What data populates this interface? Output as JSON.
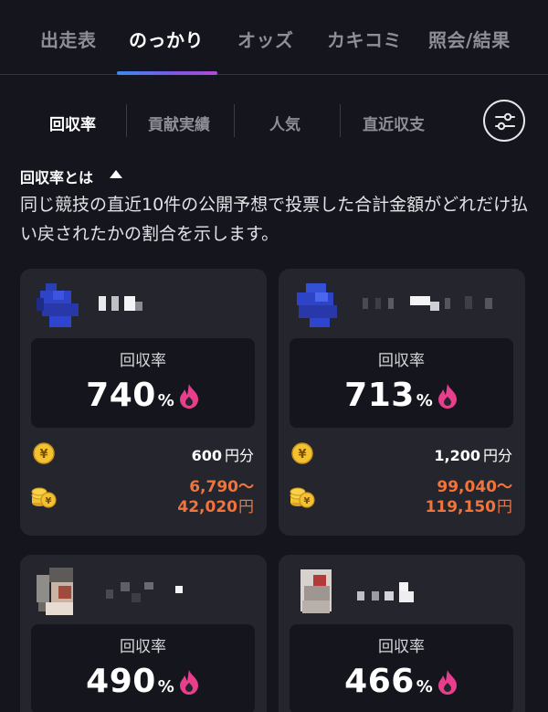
{
  "top_tabs": [
    "出走表",
    "のっかり",
    "オッズ",
    "カキコミ",
    "照会/結果"
  ],
  "active_top_tab": 1,
  "sub_tabs": [
    "回収率",
    "貢献実績",
    "人気",
    "直近収支"
  ],
  "active_sub_tab": 0,
  "info": {
    "title": "回収率とは",
    "description": "同じ競技の直近10件の公開予想で投票した合計金額がどれだけ払い戻されたかの割合を示します。"
  },
  "cards": [
    {
      "stat_label": "回収率",
      "rate": "740",
      "rate_unit": "%",
      "bet": "600",
      "bet_unit": "円分",
      "payout_min": "6,790～",
      "payout_max": "42,020",
      "payout_unit": "円"
    },
    {
      "stat_label": "回収率",
      "rate": "713",
      "rate_unit": "%",
      "bet": "1,200",
      "bet_unit": "円分",
      "payout_min": "99,040～",
      "payout_max": "119,150",
      "payout_unit": "円"
    },
    {
      "stat_label": "回収率",
      "rate": "490",
      "rate_unit": "%"
    },
    {
      "stat_label": "回収率",
      "rate": "466",
      "rate_unit": "%"
    }
  ],
  "colors": {
    "background": "#15161d",
    "card": "#24252d",
    "accent_orange": "#f0743b",
    "fire_pink": "#e83e8c"
  }
}
